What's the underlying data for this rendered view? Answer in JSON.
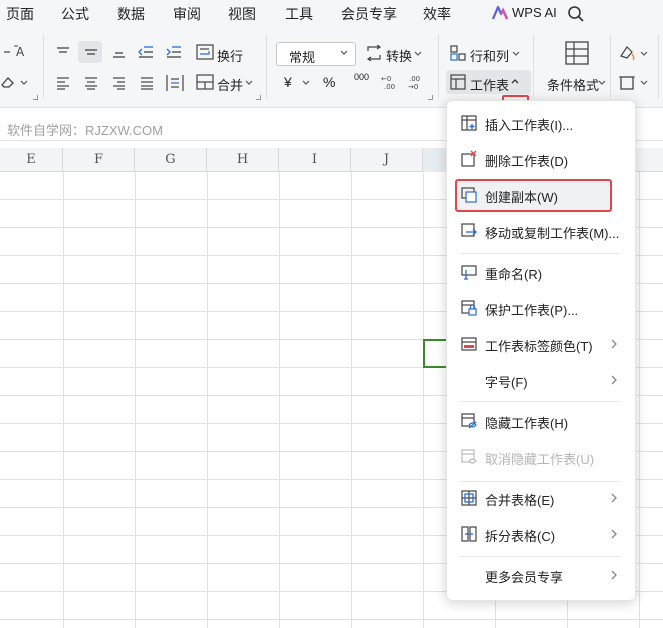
{
  "tabs": [
    "页面",
    "公式",
    "数据",
    "审阅",
    "视图",
    "工具",
    "会员专享",
    "效率"
  ],
  "wps_ai": "WPS AI",
  "ribbon": {
    "wrap_label": "换行",
    "merge_label": "合并",
    "number_format": "常规",
    "convert_label": "转换",
    "row_col_label": "行和列",
    "worksheet_label": "工作表",
    "cond_format_label": "条件格式",
    "currency_symbol": "¥",
    "percent_symbol": "%",
    "thousands_symbol": "000"
  },
  "formula_bar_text": "软件自学网：RJZXW.COM",
  "columns": [
    "E",
    "F",
    "G",
    "H",
    "I",
    "J"
  ],
  "menu": {
    "items": [
      {
        "label": "插入工作表(I)...",
        "icon": "insert-sheet-icon",
        "submenu": false,
        "disabled": false
      },
      {
        "label": "删除工作表(D)",
        "icon": "delete-sheet-icon",
        "submenu": false,
        "disabled": false
      },
      {
        "label": "创建副本(W)",
        "icon": "copy-sheet-icon",
        "submenu": false,
        "disabled": false
      },
      {
        "label": "移动或复制工作表(M)...",
        "icon": "move-copy-sheet-icon",
        "submenu": false,
        "disabled": false
      },
      {
        "label": "重命名(R)",
        "icon": "rename-icon",
        "submenu": false,
        "disabled": false
      },
      {
        "label": "保护工作表(P)...",
        "icon": "protect-sheet-icon",
        "submenu": false,
        "disabled": false
      },
      {
        "label": "工作表标签颜色(T)",
        "icon": "tab-color-icon",
        "submenu": true,
        "disabled": false
      },
      {
        "label": "字号(F)",
        "icon": "",
        "submenu": true,
        "disabled": false
      },
      {
        "label": "隐藏工作表(H)",
        "icon": "hide-sheet-icon",
        "submenu": false,
        "disabled": false
      },
      {
        "label": "取消隐藏工作表(U)",
        "icon": "unhide-sheet-icon",
        "submenu": false,
        "disabled": true
      },
      {
        "label": "合并表格(E)",
        "icon": "merge-tables-icon",
        "submenu": true,
        "disabled": false
      },
      {
        "label": "拆分表格(C)",
        "icon": "split-tables-icon",
        "submenu": true,
        "disabled": false
      },
      {
        "label": "更多会员专享",
        "icon": "",
        "submenu": true,
        "disabled": false
      }
    ]
  },
  "colors": {
    "accent": "#3a8a2c",
    "highlight_border": "#e0474c",
    "icon_blue": "#2b6cd4"
  }
}
